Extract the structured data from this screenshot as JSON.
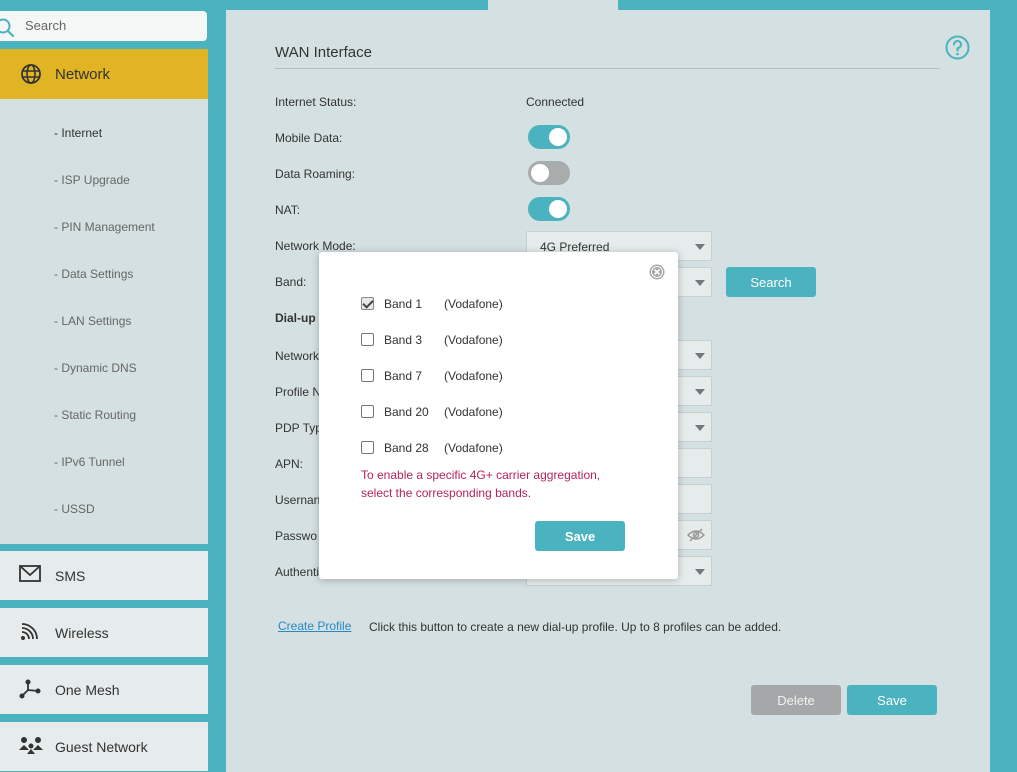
{
  "search": {
    "placeholder": "Search"
  },
  "sidebar": {
    "network_label": "Network",
    "subitems": [
      "- Internet",
      "- ISP Upgrade",
      "- PIN Management",
      "- Data Settings",
      "- LAN Settings",
      "- Dynamic DNS",
      "- Static Routing",
      "- IPv6 Tunnel",
      "- USSD"
    ],
    "sms_label": "SMS",
    "wireless_label": "Wireless",
    "onemesh_label": "One Mesh",
    "guest_label": "Guest Network"
  },
  "main": {
    "title": "WAN Interface",
    "internet_status_label": "Internet Status:",
    "internet_status_value": "Connected",
    "mobile_data_label": "Mobile Data:",
    "mobile_data_on": true,
    "data_roaming_label": "Data Roaming:",
    "data_roaming_on": false,
    "nat_label": "NAT:",
    "nat_on": true,
    "network_mode_label": "Network Mode:",
    "network_mode_value": "4G Preferred",
    "band_label": "Band:",
    "search_button": "Search",
    "dialup_label": "Dial-up",
    "network_label": "Network",
    "profile_label": "Profile N",
    "pdp_label": "PDP Typ",
    "apn_label": "APN:",
    "username_label": "Usernan",
    "password_label": "Passwo",
    "auth_label": "Authenti",
    "create_profile_link": "Create Profile",
    "create_profile_desc": "Click this button to create a new dial-up profile. Up to 8 profiles can be added.",
    "delete_button": "Delete",
    "save_button": "Save"
  },
  "modal": {
    "bands": [
      {
        "name": "Band 1",
        "carrier": "(Vodafone)",
        "checked": true
      },
      {
        "name": "Band 3",
        "carrier": "(Vodafone)",
        "checked": false
      },
      {
        "name": "Band 7",
        "carrier": "(Vodafone)",
        "checked": false
      },
      {
        "name": "Band 20",
        "carrier": "(Vodafone)",
        "checked": false
      },
      {
        "name": "Band 28",
        "carrier": "(Vodafone)",
        "checked": false
      }
    ],
    "note_line1": "To enable a specific 4G+ carrier aggregation,",
    "note_line2": "select the corresponding bands.",
    "save_button": "Save"
  },
  "colors": {
    "accent": "#4ab3bf",
    "active_nav": "#e0b422",
    "note": "#b5245b"
  }
}
